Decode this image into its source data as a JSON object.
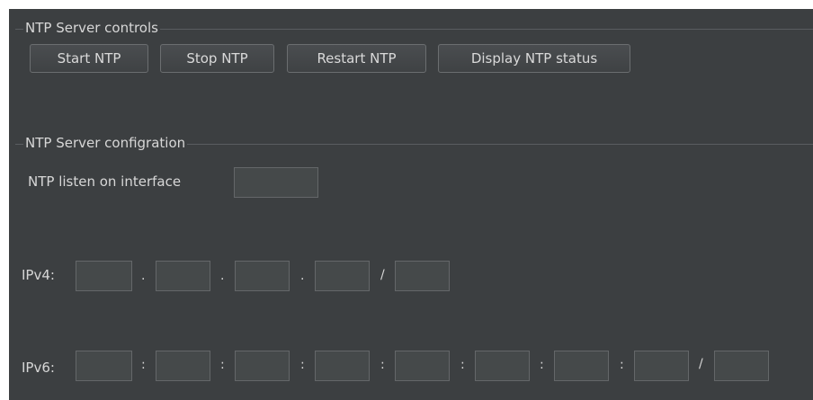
{
  "controls": {
    "title": "NTP Server controls",
    "buttons": [
      "Start NTP",
      "Stop NTP",
      "Restart NTP",
      "Display NTP status"
    ]
  },
  "config": {
    "title": "NTP Server configration",
    "listen_label": "NTP listen on interface",
    "listen_value": "",
    "ipv4_label": "IPv4:",
    "ipv4_separators": [
      ".",
      ".",
      ".",
      "/"
    ],
    "ipv6_label": "IPv6:",
    "ipv6_separators": [
      ":",
      ":",
      ":",
      ":",
      ":",
      ":",
      ":",
      ":",
      "/"
    ]
  }
}
